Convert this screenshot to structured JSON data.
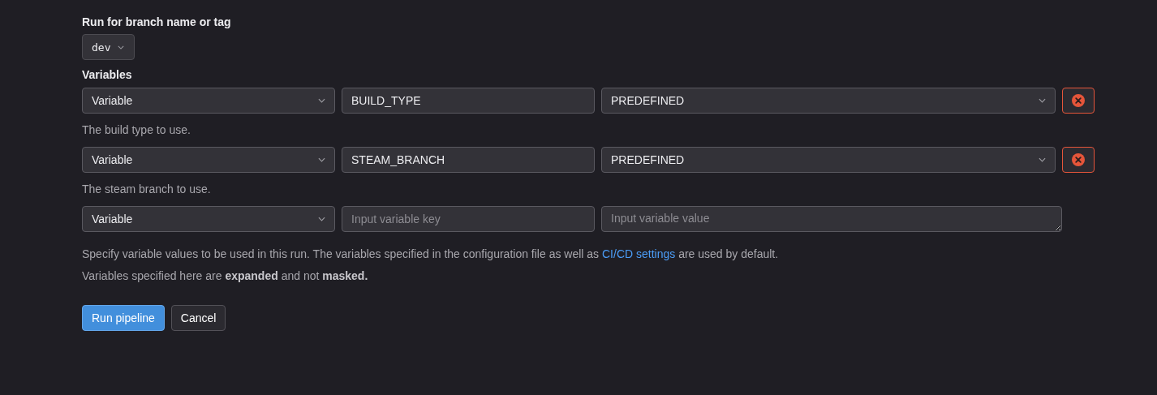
{
  "branch": {
    "label": "Run for branch name or tag",
    "value": "dev"
  },
  "variables": {
    "label": "Variables",
    "rows": [
      {
        "type": "Variable",
        "key": "BUILD_TYPE",
        "kind": "select",
        "value": "PREDEFINED",
        "removable": true,
        "description": "The build type to use."
      },
      {
        "type": "Variable",
        "key": "STEAM_BRANCH",
        "kind": "select",
        "value": "PREDEFINED",
        "removable": true,
        "description": "The steam branch to use."
      },
      {
        "type": "Variable",
        "key_placeholder": "Input variable key",
        "kind": "textarea",
        "value_placeholder": "Input variable value",
        "removable": false
      }
    ]
  },
  "help": {
    "before": "Specify variable values to be used in this run. The variables specified in the configuration file as well as",
    "link": "CI/CD settings",
    "after": "are used by default."
  },
  "note": "Variables specified here are **expanded** and not **masked.**",
  "buttons": [
    {
      "label": "Run pipeline",
      "kind": "primary"
    },
    {
      "label": "Cancel",
      "kind": "default"
    }
  ]
}
